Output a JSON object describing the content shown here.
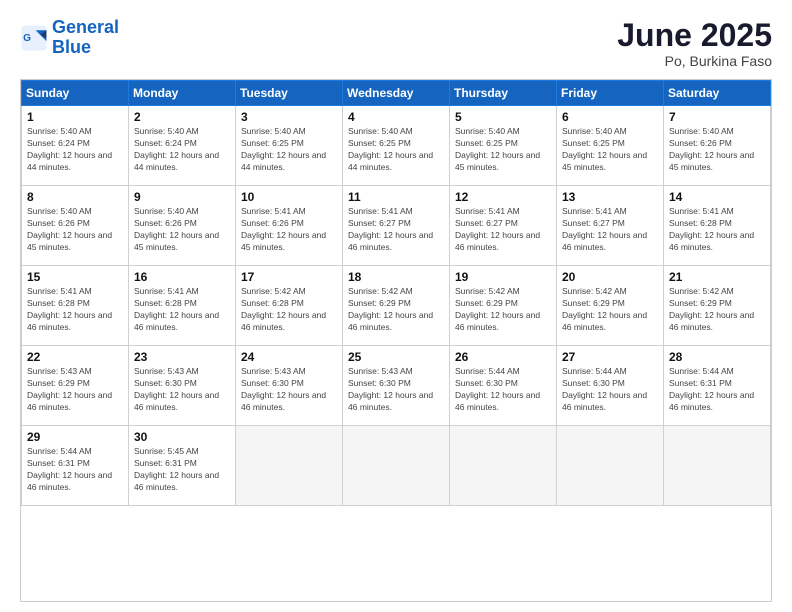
{
  "logo": {
    "line1": "General",
    "line2": "Blue"
  },
  "title": "June 2025",
  "subtitle": "Po, Burkina Faso",
  "weekdays": [
    "Sunday",
    "Monday",
    "Tuesday",
    "Wednesday",
    "Thursday",
    "Friday",
    "Saturday"
  ],
  "weeks": [
    [
      {
        "day": "1",
        "sunrise": "5:40 AM",
        "sunset": "6:24 PM",
        "daylight": "12 hours and 44 minutes."
      },
      {
        "day": "2",
        "sunrise": "5:40 AM",
        "sunset": "6:24 PM",
        "daylight": "12 hours and 44 minutes."
      },
      {
        "day": "3",
        "sunrise": "5:40 AM",
        "sunset": "6:25 PM",
        "daylight": "12 hours and 44 minutes."
      },
      {
        "day": "4",
        "sunrise": "5:40 AM",
        "sunset": "6:25 PM",
        "daylight": "12 hours and 44 minutes."
      },
      {
        "day": "5",
        "sunrise": "5:40 AM",
        "sunset": "6:25 PM",
        "daylight": "12 hours and 45 minutes."
      },
      {
        "day": "6",
        "sunrise": "5:40 AM",
        "sunset": "6:25 PM",
        "daylight": "12 hours and 45 minutes."
      },
      {
        "day": "7",
        "sunrise": "5:40 AM",
        "sunset": "6:26 PM",
        "daylight": "12 hours and 45 minutes."
      }
    ],
    [
      {
        "day": "8",
        "sunrise": "5:40 AM",
        "sunset": "6:26 PM",
        "daylight": "12 hours and 45 minutes."
      },
      {
        "day": "9",
        "sunrise": "5:40 AM",
        "sunset": "6:26 PM",
        "daylight": "12 hours and 45 minutes."
      },
      {
        "day": "10",
        "sunrise": "5:41 AM",
        "sunset": "6:26 PM",
        "daylight": "12 hours and 45 minutes."
      },
      {
        "day": "11",
        "sunrise": "5:41 AM",
        "sunset": "6:27 PM",
        "daylight": "12 hours and 46 minutes."
      },
      {
        "day": "12",
        "sunrise": "5:41 AM",
        "sunset": "6:27 PM",
        "daylight": "12 hours and 46 minutes."
      },
      {
        "day": "13",
        "sunrise": "5:41 AM",
        "sunset": "6:27 PM",
        "daylight": "12 hours and 46 minutes."
      },
      {
        "day": "14",
        "sunrise": "5:41 AM",
        "sunset": "6:28 PM",
        "daylight": "12 hours and 46 minutes."
      }
    ],
    [
      {
        "day": "15",
        "sunrise": "5:41 AM",
        "sunset": "6:28 PM",
        "daylight": "12 hours and 46 minutes."
      },
      {
        "day": "16",
        "sunrise": "5:41 AM",
        "sunset": "6:28 PM",
        "daylight": "12 hours and 46 minutes."
      },
      {
        "day": "17",
        "sunrise": "5:42 AM",
        "sunset": "6:28 PM",
        "daylight": "12 hours and 46 minutes."
      },
      {
        "day": "18",
        "sunrise": "5:42 AM",
        "sunset": "6:29 PM",
        "daylight": "12 hours and 46 minutes."
      },
      {
        "day": "19",
        "sunrise": "5:42 AM",
        "sunset": "6:29 PM",
        "daylight": "12 hours and 46 minutes."
      },
      {
        "day": "20",
        "sunrise": "5:42 AM",
        "sunset": "6:29 PM",
        "daylight": "12 hours and 46 minutes."
      },
      {
        "day": "21",
        "sunrise": "5:42 AM",
        "sunset": "6:29 PM",
        "daylight": "12 hours and 46 minutes."
      }
    ],
    [
      {
        "day": "22",
        "sunrise": "5:43 AM",
        "sunset": "6:29 PM",
        "daylight": "12 hours and 46 minutes."
      },
      {
        "day": "23",
        "sunrise": "5:43 AM",
        "sunset": "6:30 PM",
        "daylight": "12 hours and 46 minutes."
      },
      {
        "day": "24",
        "sunrise": "5:43 AM",
        "sunset": "6:30 PM",
        "daylight": "12 hours and 46 minutes."
      },
      {
        "day": "25",
        "sunrise": "5:43 AM",
        "sunset": "6:30 PM",
        "daylight": "12 hours and 46 minutes."
      },
      {
        "day": "26",
        "sunrise": "5:44 AM",
        "sunset": "6:30 PM",
        "daylight": "12 hours and 46 minutes."
      },
      {
        "day": "27",
        "sunrise": "5:44 AM",
        "sunset": "6:30 PM",
        "daylight": "12 hours and 46 minutes."
      },
      {
        "day": "28",
        "sunrise": "5:44 AM",
        "sunset": "6:31 PM",
        "daylight": "12 hours and 46 minutes."
      }
    ],
    [
      {
        "day": "29",
        "sunrise": "5:44 AM",
        "sunset": "6:31 PM",
        "daylight": "12 hours and 46 minutes."
      },
      {
        "day": "30",
        "sunrise": "5:45 AM",
        "sunset": "6:31 PM",
        "daylight": "12 hours and 46 minutes."
      },
      null,
      null,
      null,
      null,
      null
    ]
  ]
}
